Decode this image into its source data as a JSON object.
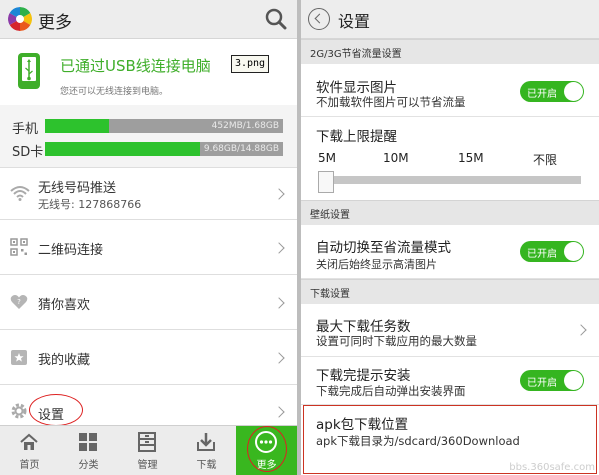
{
  "left": {
    "header": {
      "title": "更多",
      "search_icon": "search-icon"
    },
    "usb": {
      "title": "已通过USB线连接电脑",
      "subtitle": "您还可以无线连接到电脑。",
      "tag": "3.png"
    },
    "storage": [
      {
        "label": "手机",
        "text": "452MB/1.68GB",
        "fraction": 0.27
      },
      {
        "label": "SD卡",
        "text": "9.68GB/14.88GB",
        "fraction": 0.65
      }
    ],
    "menu": [
      {
        "label": "无线号码推送",
        "sub": "无线号: 127868766",
        "icon": "wifi-icon"
      },
      {
        "label": "二维码连接",
        "icon": "qr-code-icon"
      },
      {
        "label": "猜你喜欢",
        "icon": "heart-icon"
      },
      {
        "label": "我的收藏",
        "icon": "star-folder-icon"
      },
      {
        "label": "设置",
        "icon": "gear-icon"
      }
    ],
    "nav": [
      {
        "label": "首页",
        "icon": "home-icon"
      },
      {
        "label": "分类",
        "icon": "grid-icon"
      },
      {
        "label": "管理",
        "icon": "manage-icon"
      },
      {
        "label": "下载",
        "icon": "download-icon"
      },
      {
        "label": "更多",
        "icon": "more-icon"
      }
    ]
  },
  "right": {
    "header": {
      "title": "设置"
    },
    "sections": {
      "traffic": "2G/3G节省流量设置",
      "wallpaper": "壁纸设置",
      "download": "下载设置"
    },
    "show_images": {
      "title": "软件显示图片",
      "subtitle": "不加载软件图片可以节省流量",
      "toggle": "已开启"
    },
    "download_limit": {
      "title": "下载上限提醒",
      "ticks": [
        "5M",
        "10M",
        "15M",
        "不限"
      ],
      "selected": "5M"
    },
    "auto_switch": {
      "title": "自动切换至省流量模式",
      "subtitle": "关闭后始终显示高清图片",
      "toggle": "已开启"
    },
    "max_tasks": {
      "title": "最大下载任务数",
      "subtitle": "设置可同时下载应用的最大数量"
    },
    "install_prompt": {
      "title": "下载完提示安装",
      "subtitle": "下载完成后自动弹出安装界面",
      "toggle": "已开启"
    },
    "apk_location": {
      "title": "apk包下载位置",
      "subtitle": "apk下载目录为/sdcard/360Download"
    }
  },
  "watermark": "bbs.360safe.com",
  "colors": {
    "accent": "#35b520",
    "highlight": "#cc2222"
  }
}
